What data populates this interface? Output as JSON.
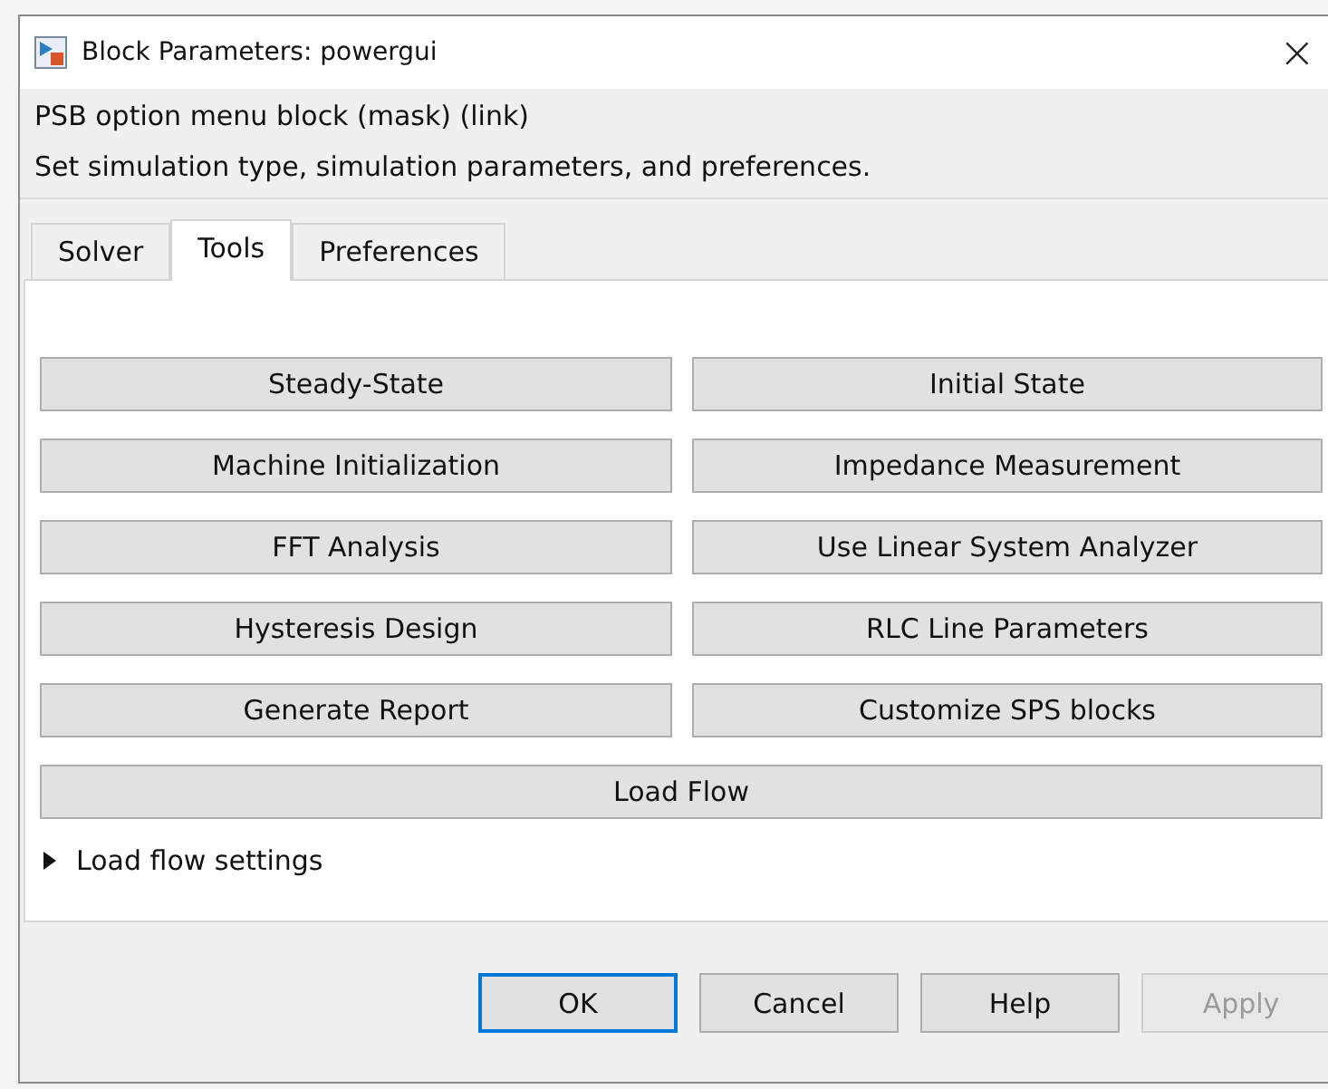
{
  "window": {
    "title": "Block Parameters: powergui",
    "close": "×"
  },
  "group_title": "PSB option menu block (mask) (link)",
  "description": "Set simulation type, simulation parameters, and preferences.",
  "tabs": [
    {
      "label": "Solver",
      "selected": false
    },
    {
      "label": "Tools",
      "selected": true
    },
    {
      "label": "Preferences",
      "selected": false
    }
  ],
  "tool_buttons": [
    "Steady-State",
    "Initial State",
    "Machine Initialization",
    "Impedance Measurement",
    "FFT Analysis",
    "Use Linear System Analyzer",
    "Hysteresis Design",
    "RLC Line Parameters",
    "Generate Report",
    "Customize SPS blocks"
  ],
  "wide_button": "Load Flow",
  "expander": {
    "label": "Load flow settings",
    "expanded": false
  },
  "buttons": [
    {
      "label": "OK",
      "focused": true,
      "disabled": false
    },
    {
      "label": "Cancel",
      "focused": false,
      "disabled": false
    },
    {
      "label": "Help",
      "focused": false,
      "disabled": false
    },
    {
      "label": "Apply",
      "focused": false,
      "disabled": true
    }
  ]
}
